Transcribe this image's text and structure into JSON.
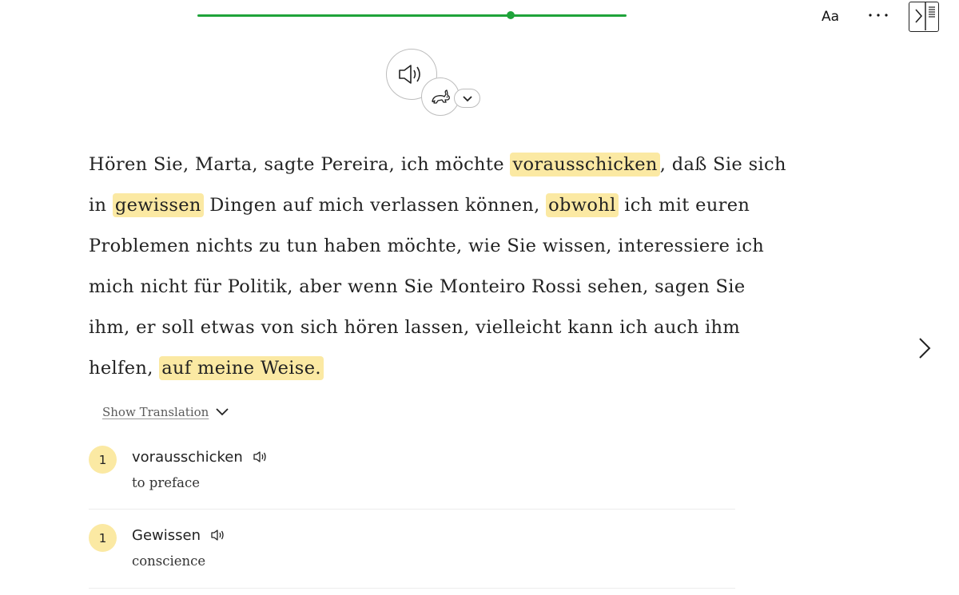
{
  "progress": {
    "fraction": 0.73
  },
  "toolbar": {
    "font_label": "Aa",
    "more_label": "···"
  },
  "passage": {
    "lines": [
      {
        "segments": [
          {
            "text": "Hören Sie, Marta, sagte Pereira, ich möchte "
          },
          {
            "text": "vorausschicken",
            "highlight": true
          },
          {
            "text": ", daß Sie sich"
          }
        ]
      },
      {
        "segments": [
          {
            "text": "in "
          },
          {
            "text": "gewissen",
            "highlight": true
          },
          {
            "text": " Dingen auf mich verlassen können, "
          },
          {
            "text": "obwohl",
            "highlight": true
          },
          {
            "text": " ich mit euren"
          }
        ]
      },
      {
        "segments": [
          {
            "text": "Problemen nichts zu tun haben möchte, wie Sie wissen, interessiere ich"
          }
        ]
      },
      {
        "segments": [
          {
            "text": "mich nicht für Politik, aber wenn Sie Monteiro Rossi sehen, sagen Sie"
          }
        ]
      },
      {
        "segments": [
          {
            "text": "ihm, er soll etwas von sich hören lassen, vielleicht kann ich auch ihm"
          }
        ]
      },
      {
        "segments": [
          {
            "text": "helfen, "
          },
          {
            "text": "auf meine Weise.",
            "highlight": true
          }
        ]
      }
    ]
  },
  "translation_toggle": {
    "label": "Show Translation"
  },
  "vocabulary": [
    {
      "count": "1",
      "word": "vorausschicken",
      "meaning": "to preface"
    },
    {
      "count": "1",
      "word": "Gewissen",
      "meaning": "conscience"
    }
  ],
  "colors": {
    "accent_green": "#1fa33a",
    "highlight": "#fbe9a3"
  }
}
